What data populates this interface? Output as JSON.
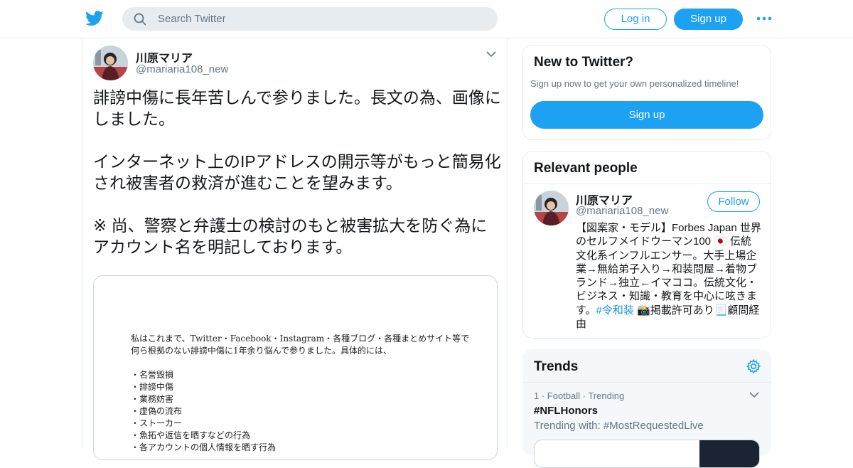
{
  "header": {
    "search_placeholder": "Search Twitter",
    "login_label": "Log in",
    "signup_label": "Sign up",
    "brand_color": "#1da1f2"
  },
  "tweet": {
    "author_name": "川原マリア",
    "author_handle": "@mariaria108_new",
    "paragraphs": [
      "誹謗中傷に長年苦しんで参りました。長文の為、画像にしました。",
      "",
      "インターネット上のIPアドレスの開示等がもっと簡易化され被害者の救済が進むことを望みます。",
      "",
      "※ 尚、警察と弁護士の検討のもと被害拡大を防ぐ為にアカウント名を明記しております。"
    ],
    "image_document": {
      "intro": "私はこれまで、Twitter・Facebook・Instagram・各種ブログ・各種まとめサイト等で何ら根拠のない誹謗中傷に1年余り悩んで参りました。具体的には、",
      "items": [
        "・名誉毀損",
        "・誹謗中傷",
        "・業務妨害",
        "・虚偽の流布",
        "・ストーカー",
        "・魚拓や返信を晒すなどの行為",
        "・各アカウントの個人情報を晒す行為"
      ]
    }
  },
  "sidebar": {
    "new_to_twitter": {
      "title": "New to Twitter?",
      "subtitle": "Sign up now to get your own personalized timeline!",
      "button": "Sign up"
    },
    "relevant_people": {
      "title": "Relevant people",
      "name": "川原マリア",
      "handle": "@mariaria108_new",
      "follow_label": "Follow",
      "bio_before_hashtag": "【図案家・モデル】Forbes Japan 世界のセルフメイドウーマン100 🇯🇵 伝統文化系インフルエンサー。大手上場企業→無給弟子入り→和装問屋→着物ブランド→独立←イマココ。伝統文化・ビジネス・知識・教育を中心に呟きます。",
      "hashtag": "#令和装",
      "bio_after_hashtag": " 📸掲載許可あり📃顧問経由"
    },
    "trends": {
      "title": "Trends",
      "items": [
        {
          "meta": "1 · Football · Trending",
          "name": "#NFLHonors",
          "with": "Trending with: #MostRequestedLive"
        }
      ]
    }
  }
}
